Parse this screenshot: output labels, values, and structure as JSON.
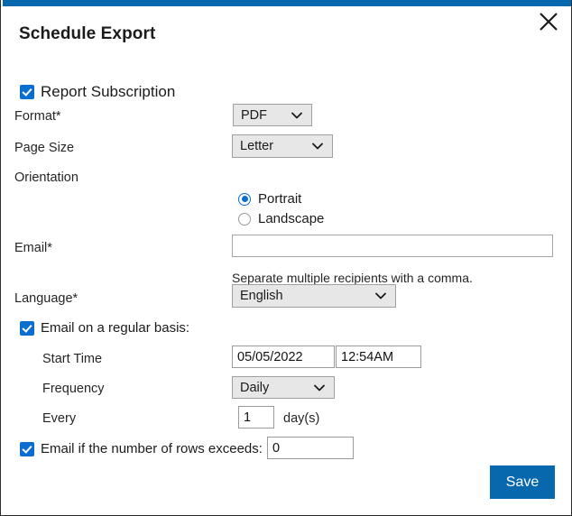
{
  "dialog": {
    "title": "Schedule Export",
    "close_icon": "close-icon",
    "accent_color": "#0768ae"
  },
  "subscription": {
    "checkbox_label": "Report Subscription",
    "checked": true
  },
  "fields": {
    "format": {
      "label": "Format*",
      "value": "PDF",
      "options": [
        "PDF"
      ]
    },
    "page_size": {
      "label": "Page Size",
      "value": "Letter",
      "options": [
        "Letter"
      ]
    },
    "orientation": {
      "label": "Orientation",
      "options": [
        {
          "label": "Portrait",
          "selected": true
        },
        {
          "label": "Landscape",
          "selected": false
        }
      ]
    },
    "email": {
      "label": "Email*",
      "value": "",
      "placeholder": "",
      "hint": "Separate multiple recipients with a comma."
    },
    "language": {
      "label": "Language*",
      "value": "English",
      "options": [
        "English"
      ]
    }
  },
  "schedule": {
    "checkbox_label": "Email on a regular basis:",
    "checked": true,
    "start_time": {
      "label": "Start Time",
      "date_value": "05/05/2022",
      "time_value": "12:54AM"
    },
    "frequency": {
      "label": "Frequency",
      "value": "Daily",
      "options": [
        "Daily"
      ]
    },
    "every": {
      "label": "Every",
      "value": "1",
      "unit": "day(s)"
    }
  },
  "row_threshold": {
    "checkbox_label": "Email if the number of rows exceeds:",
    "checked": true,
    "value": "0"
  },
  "footer": {
    "save_label": "Save",
    "save_color": "#0768ae"
  }
}
